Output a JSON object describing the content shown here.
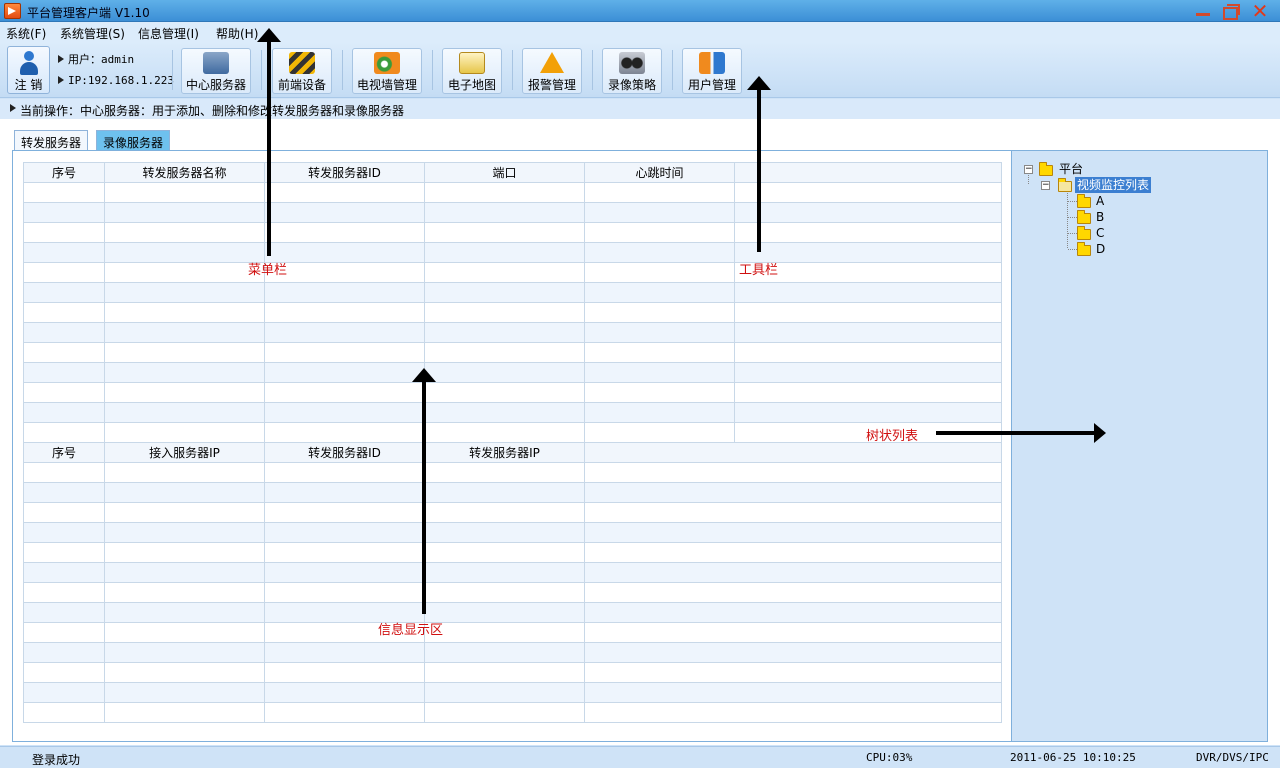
{
  "window": {
    "title": "平台管理客户端 V1.10"
  },
  "menu": {
    "items": [
      "系统(F)",
      "系统管理(S)",
      "信息管理(I)",
      "帮助(H)"
    ]
  },
  "toolbar": {
    "logout_label": "注 销",
    "user_line": "用户：admin",
    "ip_line": "IP:192.168.1.223",
    "buttons": [
      "中心服务器",
      "前端设备",
      "电视墙管理",
      "电子地图",
      "报警管理",
      "录像策略",
      "用户管理"
    ]
  },
  "operation": {
    "text": "当前操作：中心服务器：用于添加、删除和修改转发服务器和录像服务器"
  },
  "tabs": [
    "转发服务器",
    "录像服务器"
  ],
  "grid1": {
    "headers": [
      "序号",
      "转发服务器名称",
      "转发服务器ID",
      "端口",
      "心跳时间",
      ""
    ]
  },
  "grid2": {
    "headers": [
      "序号",
      "接入服务器IP",
      "转发服务器ID",
      "转发服务器IP",
      ""
    ]
  },
  "tree": {
    "root": "平台",
    "child": "视频监控列表",
    "leaves": [
      "A",
      "B",
      "C",
      "D"
    ]
  },
  "annotations": {
    "menubar": "菜单栏",
    "toolbar": "工具栏",
    "info_area": "信息显示区",
    "tree_list": "树状列表"
  },
  "status": {
    "login": "登录成功",
    "cpu": "CPU:03%",
    "datetime": "2011-06-25 10:10:25",
    "device": "DVR/DVS/IPC"
  }
}
